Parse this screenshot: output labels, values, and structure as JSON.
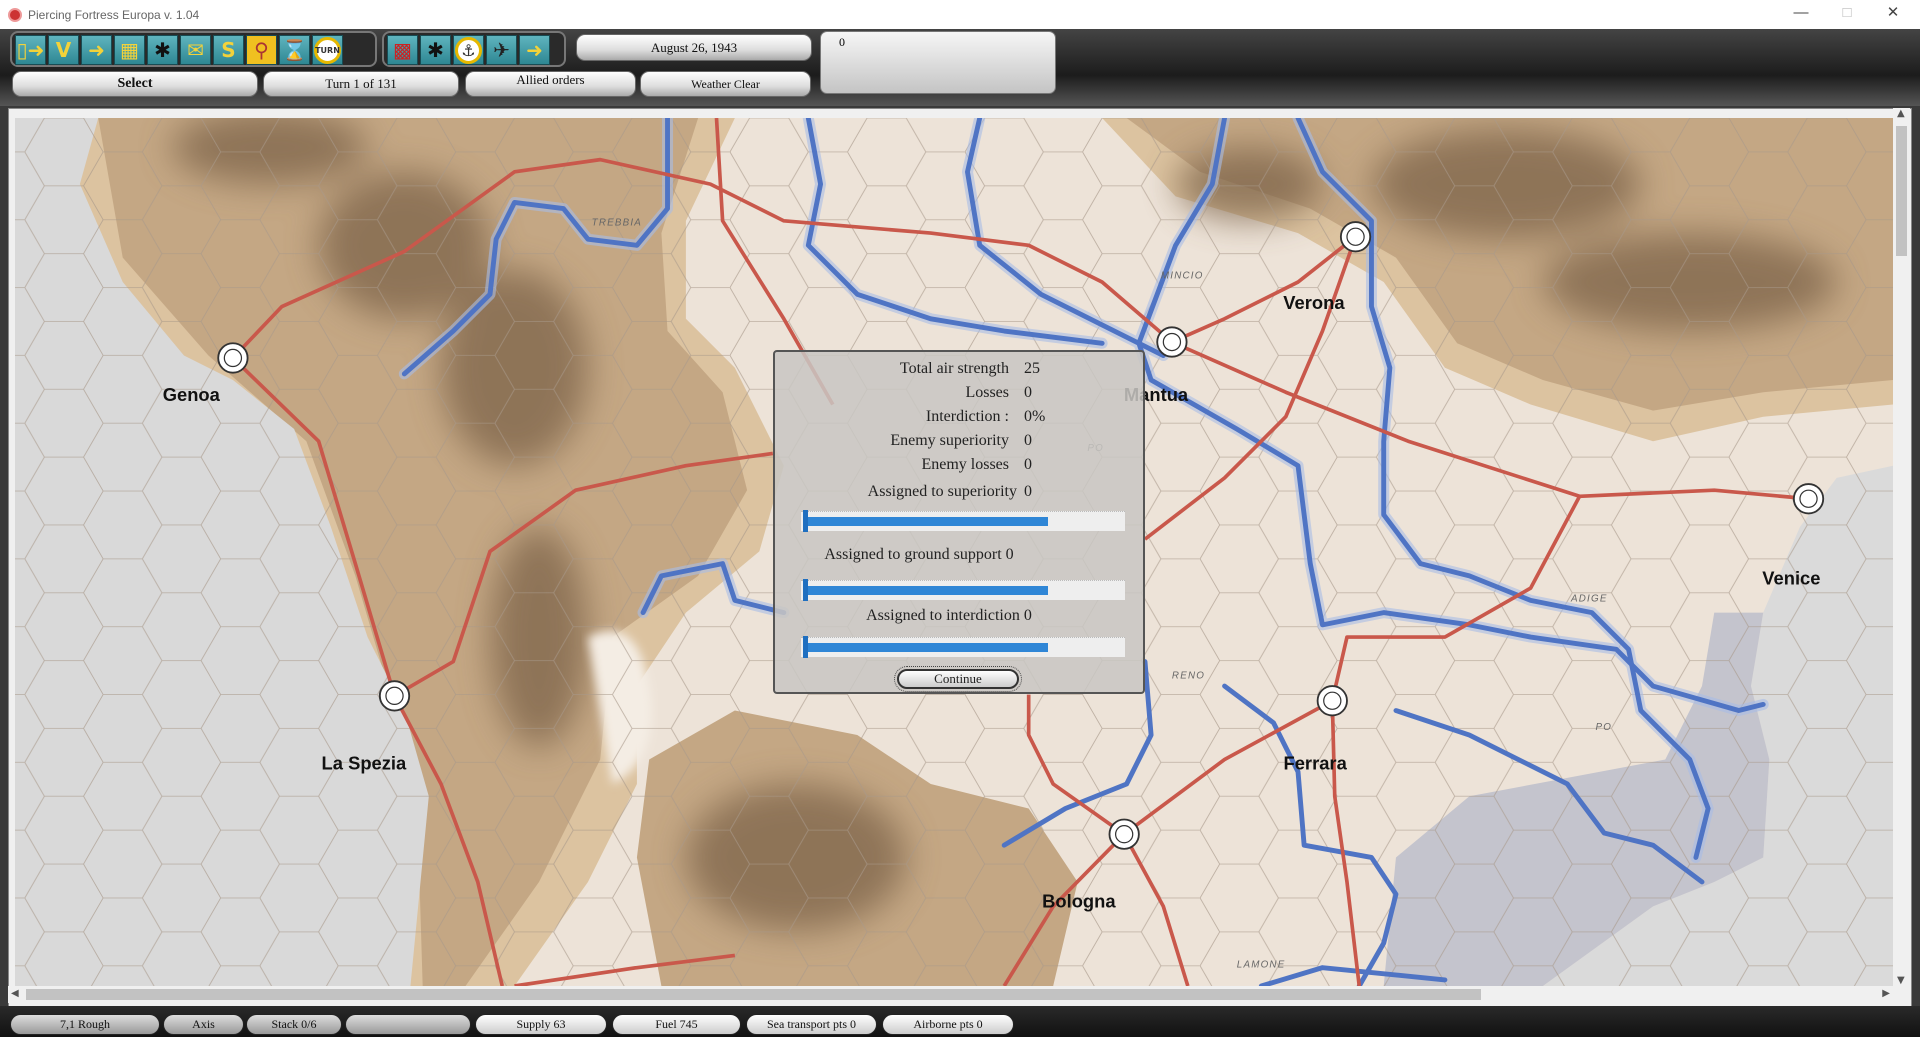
{
  "window": {
    "title": "Piercing Fortress Europa   v. 1.04",
    "controls": [
      "minimize",
      "maximize",
      "close"
    ]
  },
  "toolbar": {
    "group1": [
      "unit-out-icon",
      "victory-icon",
      "unit-in-icon",
      "supply-crates-icon",
      "soldier-icon",
      "message-help-icon",
      "supply-s-icon",
      "search-magnifier-icon",
      "hourglass-icon",
      "end-turn-icon"
    ],
    "group2": [
      "chart-icon",
      "troops-icon",
      "anchor-icon",
      "airplane-icon",
      "arrow-right-icon"
    ],
    "turn_icon_label": "TURN",
    "victory_label": "V",
    "supply_label": "S",
    "date": "August 26, 1943",
    "mode": "Select",
    "turn": "Turn 1 of 131",
    "orders": "Allied orders",
    "weather": "Weather Clear",
    "info_value": "0"
  },
  "map": {
    "cities": [
      {
        "name": "Genoa"
      },
      {
        "name": "La Spezia"
      },
      {
        "name": "Mantua"
      },
      {
        "name": "Verona"
      },
      {
        "name": "Venice"
      },
      {
        "name": "Ferrara"
      },
      {
        "name": "Bologna"
      }
    ],
    "rivers": [
      "TREBBIA",
      "MINCIO",
      "PO",
      "ADIGE",
      "RENO",
      "PO",
      "LAMONE"
    ]
  },
  "dialog": {
    "rows": [
      {
        "label": "Total air strength",
        "value": "25"
      },
      {
        "label": "Losses",
        "value": "0"
      },
      {
        "label": "Interdiction :",
        "value": "0%"
      },
      {
        "label": "Enemy superiority",
        "value": "0"
      },
      {
        "label": "Enemy losses",
        "value": "0"
      },
      {
        "label": "Assigned to superiority",
        "value": "0"
      }
    ],
    "ground_support": "Assigned to ground support  0",
    "interdiction": "Assigned to interdiction  0",
    "continue": "Continue"
  },
  "status": [
    "7,1   Rough",
    "Axis",
    "Stack 0/6",
    "",
    "Supply  63",
    "Fuel 745",
    "Sea transport pts 0",
    "Airborne pts 0"
  ]
}
